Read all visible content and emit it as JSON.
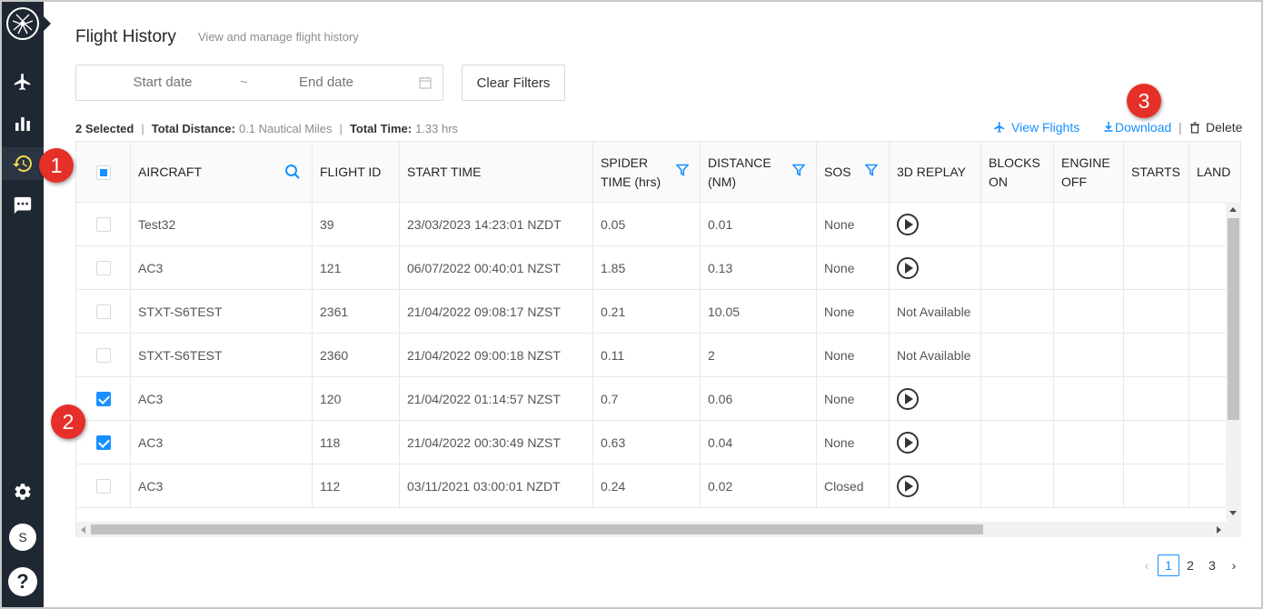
{
  "sidebar": {
    "items": [
      {
        "name": "airplane-icon",
        "active": false
      },
      {
        "name": "bar-chart-icon",
        "active": false
      },
      {
        "name": "history-icon",
        "active": true
      },
      {
        "name": "chat-icon",
        "active": false
      },
      {
        "name": "gear-icon",
        "active": false
      }
    ],
    "avatar_initial": "S",
    "help_label": "?"
  },
  "header": {
    "title": "Flight History",
    "subtitle": "View and manage flight history"
  },
  "filters": {
    "start_placeholder": "Start date",
    "separator": "~",
    "end_placeholder": "End date",
    "clear_label": "Clear Filters"
  },
  "summary": {
    "selected": "2 Selected",
    "distance_label": "Total Distance:",
    "distance_value": "0.1 Nautical Miles",
    "time_label": "Total Time:",
    "time_value": "1.33 hrs"
  },
  "actions": {
    "view_flights": "View Flights",
    "download": "Download",
    "delete": "Delete"
  },
  "table": {
    "columns": [
      {
        "label": "AIRCRAFT"
      },
      {
        "label": "FLIGHT ID"
      },
      {
        "label": "START TIME"
      },
      {
        "label": "SPIDER TIME (hrs)"
      },
      {
        "label": "DISTANCE (NM)"
      },
      {
        "label": "SOS"
      },
      {
        "label": "3D REPLAY"
      },
      {
        "label": "BLOCKS ON"
      },
      {
        "label": "ENGINE OFF"
      },
      {
        "label": "STARTS"
      },
      {
        "label": "LAND"
      }
    ],
    "rows": [
      {
        "checked": false,
        "aircraft": "Test32",
        "flight_id": "39",
        "start_time": "23/03/2023 14:23:01 NZDT",
        "spider_time": "0.05",
        "distance": "0.01",
        "sos": "None",
        "replay": "play",
        "replay_text": ""
      },
      {
        "checked": false,
        "aircraft": "AC3",
        "flight_id": "121",
        "start_time": "06/07/2022 00:40:01 NZST",
        "spider_time": "1.85",
        "distance": "0.13",
        "sos": "None",
        "replay": "play",
        "replay_text": ""
      },
      {
        "checked": false,
        "aircraft": "STXT-S6TEST",
        "flight_id": "2361",
        "start_time": "21/04/2022 09:08:17 NZST",
        "spider_time": "0.21",
        "distance": "10.05",
        "sos": "None",
        "replay": "text",
        "replay_text": "Not Available"
      },
      {
        "checked": false,
        "aircraft": "STXT-S6TEST",
        "flight_id": "2360",
        "start_time": "21/04/2022 09:00:18 NZST",
        "spider_time": "0.11",
        "distance": "2",
        "sos": "None",
        "replay": "text",
        "replay_text": "Not Available"
      },
      {
        "checked": true,
        "aircraft": "AC3",
        "flight_id": "120",
        "start_time": "21/04/2022 01:14:57 NZST",
        "spider_time": "0.7",
        "distance": "0.06",
        "sos": "None",
        "replay": "play",
        "replay_text": ""
      },
      {
        "checked": true,
        "aircraft": "AC3",
        "flight_id": "118",
        "start_time": "21/04/2022 00:30:49 NZST",
        "spider_time": "0.63",
        "distance": "0.04",
        "sos": "None",
        "replay": "play",
        "replay_text": ""
      },
      {
        "checked": false,
        "aircraft": "AC3",
        "flight_id": "112",
        "start_time": "03/11/2021 03:00:01 NZDT",
        "spider_time": "0.24",
        "distance": "0.02",
        "sos": "Closed",
        "replay": "play",
        "replay_text": ""
      }
    ]
  },
  "pagination": {
    "pages": [
      "1",
      "2",
      "3"
    ],
    "current": "1"
  },
  "callouts": [
    "1",
    "2",
    "3"
  ],
  "colors": {
    "sidebar_bg": "#1f2733",
    "accent": "#1890ff",
    "active_icon": "#f5d94e",
    "callout": "#e5302a"
  }
}
